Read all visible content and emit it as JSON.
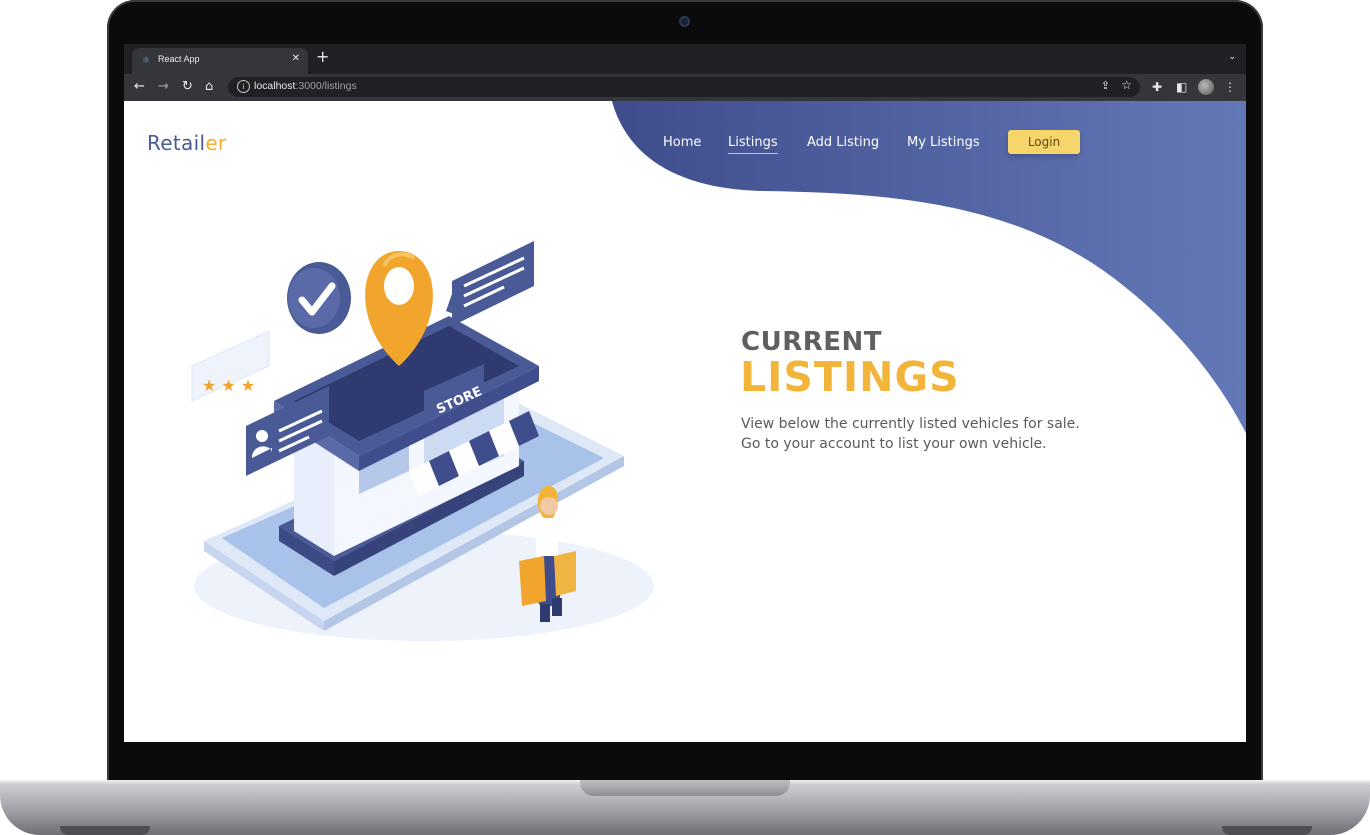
{
  "browser": {
    "tab_title": "React App",
    "tab_favicon": "react-icon",
    "url_host": "localhost",
    "url_rest": ":3000/listings"
  },
  "site": {
    "brand_main": "Retail",
    "brand_accent": "er",
    "nav": [
      {
        "label": "Home",
        "active": false
      },
      {
        "label": "Listings",
        "active": true
      },
      {
        "label": "Add Listing",
        "active": false
      },
      {
        "label": "My Listings",
        "active": false
      }
    ],
    "login_label": "Login"
  },
  "hero": {
    "heading_top": "CURRENT",
    "heading_main": "LISTINGS",
    "line1": "View below the currently listed vehicles for sale.",
    "line2": "Go to your account to list your own vehicle."
  },
  "illustration": {
    "sign_text": "STORE"
  },
  "colors": {
    "brand_blue": "#4a5a97",
    "accent_yellow": "#f2b53a",
    "login_bg": "#f6d56a",
    "wave_start": "#3f4d8c",
    "wave_end": "#6478b8"
  }
}
